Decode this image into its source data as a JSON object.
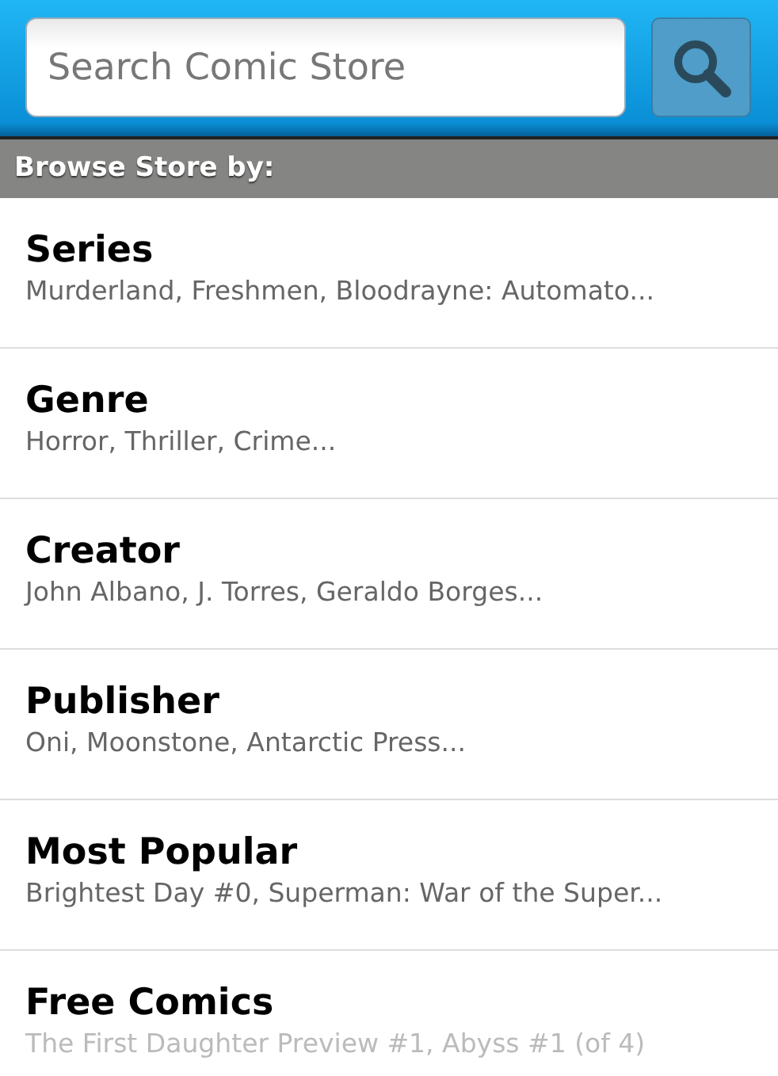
{
  "search": {
    "placeholder": "Search Comic Store"
  },
  "section_header": "Browse Store by:",
  "categories": [
    {
      "title": "Series",
      "subtitle": "Murderland, Freshmen, Bloodrayne: Automato..."
    },
    {
      "title": "Genre",
      "subtitle": "Horror, Thriller, Crime..."
    },
    {
      "title": "Creator",
      "subtitle": "John Albano, J. Torres, Geraldo Borges..."
    },
    {
      "title": "Publisher",
      "subtitle": "Oni, Moonstone, Antarctic Press..."
    },
    {
      "title": "Most Popular",
      "subtitle": "Brightest Day #0, Superman: War of the Super..."
    },
    {
      "title": "Free Comics",
      "subtitle": "The First Daughter Preview #1, Abyss #1 (of 4)"
    }
  ]
}
